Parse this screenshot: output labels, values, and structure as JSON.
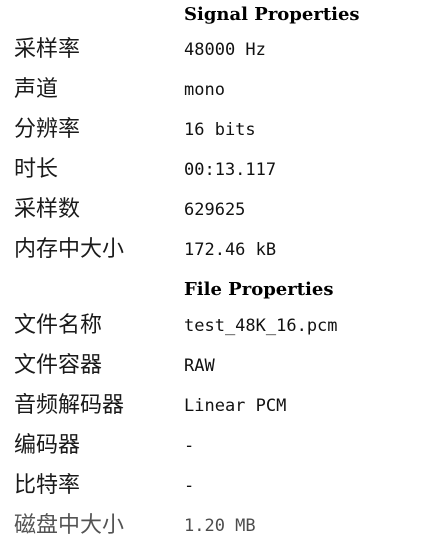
{
  "signal": {
    "header": "Signal Properties",
    "rows": [
      {
        "label": "采样率",
        "value": "48000 Hz"
      },
      {
        "label": "声道",
        "value": "mono"
      },
      {
        "label": "分辨率",
        "value": "16 bits"
      },
      {
        "label": "时长",
        "value": "00:13.117"
      },
      {
        "label": "采样数",
        "value": "629625"
      },
      {
        "label": "内存中大小",
        "value": "172.46 kB"
      }
    ]
  },
  "file": {
    "header": "File Properties",
    "rows": [
      {
        "label": "文件名称",
        "value": "test_48K_16.pcm"
      },
      {
        "label": "文件容器",
        "value": "RAW"
      },
      {
        "label": "音频解码器",
        "value": "Linear PCM"
      },
      {
        "label": "编码器",
        "value": "-"
      },
      {
        "label": "比特率",
        "value": "-"
      },
      {
        "label": "磁盘中大小",
        "value": "1.20 MB"
      }
    ]
  }
}
